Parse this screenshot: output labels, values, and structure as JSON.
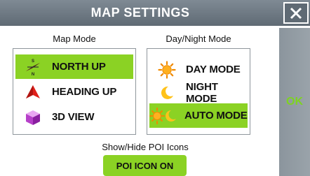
{
  "dialog": {
    "title": "MAP SETTINGS",
    "ok_label": "OK"
  },
  "map_mode": {
    "label": "Map Mode",
    "options": [
      {
        "label": "NORTH UP",
        "icon": "compass-icon",
        "selected": true
      },
      {
        "label": "HEADING UP",
        "icon": "heading-arrow-icon",
        "selected": false
      },
      {
        "label": "3D VIEW",
        "icon": "cube-icon",
        "selected": false
      }
    ]
  },
  "day_night_mode": {
    "label": "Day/Night Mode",
    "options": [
      {
        "label": "DAY MODE",
        "icon": "sun-icon",
        "selected": false
      },
      {
        "label": "NIGHT MODE",
        "icon": "moon-icon",
        "selected": false
      },
      {
        "label": "AUTO MODE",
        "icon": "sun-moon-icon",
        "selected": true
      }
    ]
  },
  "poi": {
    "label": "Show/Hide POI Icons",
    "button_label": "POI ICON ON"
  },
  "colors": {
    "selected": "#8bd224",
    "titlebar": "#6b7680",
    "ok_text": "#7ed321"
  }
}
